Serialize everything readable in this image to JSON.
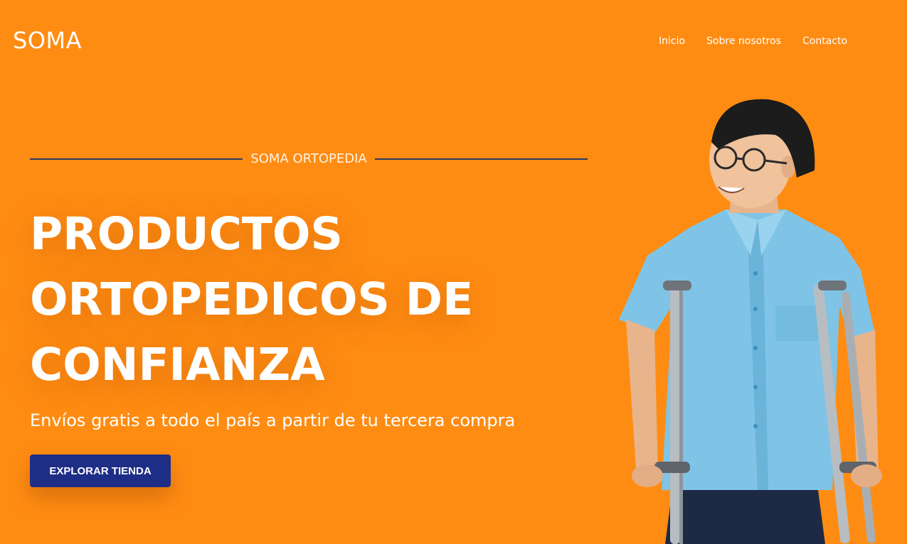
{
  "header": {
    "logo": "SOMA",
    "nav": [
      {
        "label": "Inicio"
      },
      {
        "label": "Sobre nosotros"
      },
      {
        "label": "Contacto"
      }
    ]
  },
  "hero": {
    "eyebrow": "SOMA ORTOPEDIA",
    "headline_lines": [
      "PRODUCTOS",
      "ORTOPEDICOS DE",
      "CONFIANZA"
    ],
    "subtitle": "Envíos gratis a todo el país a partir de tu tercera compra",
    "cta_label": "EXPLORAR TIENDA",
    "image_alt": "man-with-crutches-photo"
  },
  "colors": {
    "background": "#FF8C12",
    "cta": "#1E2E86",
    "divider": "#2B3A67",
    "shirt": "#7FC4E6"
  }
}
